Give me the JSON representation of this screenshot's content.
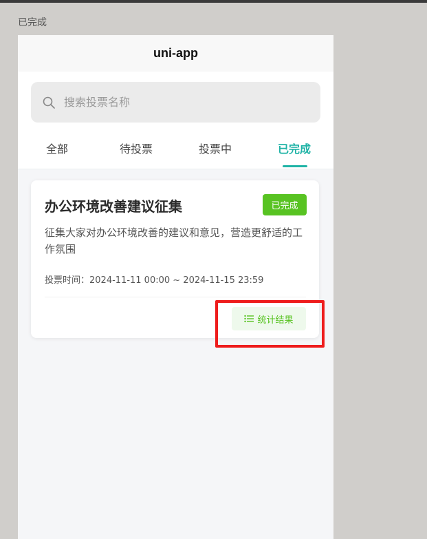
{
  "caption": "已完成",
  "navbar": {
    "title": "uni-app"
  },
  "search": {
    "placeholder": "搜索投票名称",
    "value": ""
  },
  "tabs": [
    {
      "label": "全部"
    },
    {
      "label": "待投票"
    },
    {
      "label": "投票中"
    },
    {
      "label": "已完成",
      "active": true
    }
  ],
  "card": {
    "title": "办公环境改善建议征集",
    "status": "已完成",
    "description": "征集大家对办公环境改善的建议和意见，营造更舒适的工作氛围",
    "time": "投票时间：2024-11-11 00:00 ~ 2024-11-15 23:59",
    "action_label": "统计结果"
  },
  "colors": {
    "accent": "#1fb3a6",
    "status_green": "#58c322",
    "highlight_red": "#ee1c1c"
  },
  "icons": {
    "search": "search-icon",
    "stats": "list-icon"
  }
}
